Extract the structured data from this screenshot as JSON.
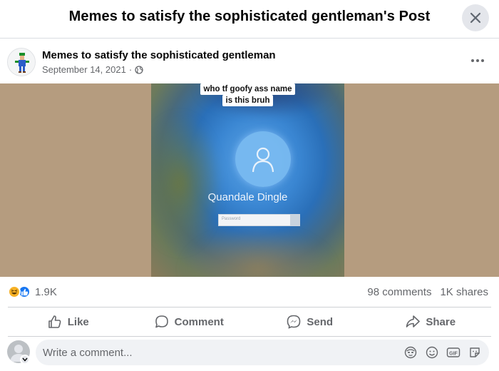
{
  "header": {
    "title": "Memes to satisfy the sophisticated gentleman's Post",
    "close_icon": "close-icon"
  },
  "post": {
    "page_name": "Memes to satisfy the sophisticated gentleman",
    "date": "September 14, 2021",
    "separator": "·",
    "audience_icon": "globe-icon",
    "more_icon": "more-horizontal-icon"
  },
  "media": {
    "caption_line1": "who tf goofy ass name",
    "caption_line2": "is this bruh",
    "login_name": "Quandale Dingle",
    "password_placeholder": "Password",
    "background_color": "#b59c7f"
  },
  "stats": {
    "reaction_icons": [
      "haha-icon",
      "like-icon"
    ],
    "reaction_count": "1.9K",
    "comments": "98 comments",
    "shares": "1K shares"
  },
  "actions": [
    {
      "label": "Like",
      "icon": "like-outline-icon"
    },
    {
      "label": "Comment",
      "icon": "comment-icon"
    },
    {
      "label": "Send",
      "icon": "messenger-icon"
    },
    {
      "label": "Share",
      "icon": "share-icon"
    }
  ],
  "comment": {
    "placeholder": "Write a comment...",
    "tools": [
      "avatar-sticker-icon",
      "emoji-icon",
      "gif-icon",
      "sticker-icon"
    ]
  },
  "colors": {
    "primary_text": "#050505",
    "secondary_text": "#65676b",
    "like_blue": "#1877f2",
    "haha_yellow": "#f7b125",
    "divider": "#ced0d4",
    "input_bg": "#f0f2f5"
  }
}
